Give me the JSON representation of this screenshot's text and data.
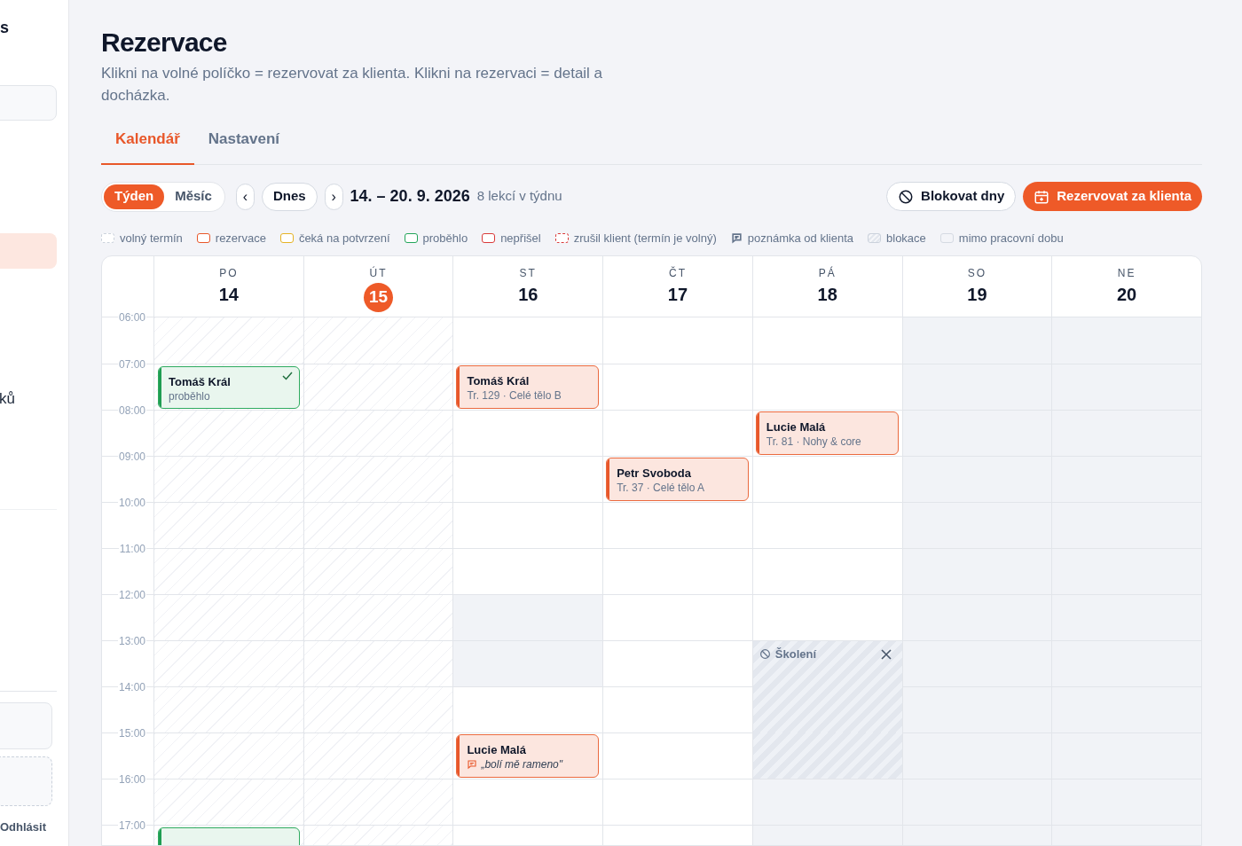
{
  "sidebar": {
    "heading_fragment": "s",
    "items": [
      {
        "selected": true
      },
      {
        "label": "ků",
        "selected": false
      }
    ],
    "logout": "Odhlásit"
  },
  "page": {
    "title": "Rezervace",
    "subtitle": "Klikni na volné políčko = rezervovat za klienta. Klikni na rezervaci = detail a docházka."
  },
  "tabs": [
    {
      "label": "Kalendář",
      "selected": true
    },
    {
      "label": "Nastavení",
      "selected": false
    }
  ],
  "toolbar": {
    "views": [
      {
        "label": "Týden",
        "selected": true
      },
      {
        "label": "Měsíc",
        "selected": false
      }
    ],
    "prev": "‹",
    "today": "Dnes",
    "next": "›",
    "range": "14. – 20. 9. 2026",
    "count": "8 lekcí v týdnu",
    "block_button": "Blokovat dny",
    "book_button": "Rezervovat za klienta"
  },
  "legend": [
    {
      "label": "volný termín",
      "kind": "dashed",
      "color": "#cbd2dc"
    },
    {
      "label": "rezervace",
      "kind": "solid",
      "color": "#e8572a"
    },
    {
      "label": "čeká na potvrzení",
      "kind": "solid",
      "color": "#e6b325"
    },
    {
      "label": "proběhlo",
      "kind": "solid",
      "color": "#22a55a"
    },
    {
      "label": "nepřišel",
      "kind": "solid",
      "color": "#d93a3a"
    },
    {
      "label": "zrušil klient (termín je volný)",
      "kind": "dashed",
      "color": "#d93a3a"
    },
    {
      "label": "poznámka od klienta",
      "kind": "icon",
      "color": "#64748b"
    },
    {
      "label": "blokace",
      "kind": "hatched",
      "color": "#cbd2dc"
    },
    {
      "label": "mimo pracovní dobu",
      "kind": "muted",
      "color": "#d5dae2"
    }
  ],
  "calendar": {
    "days": [
      {
        "weekday": "PO",
        "date": "14",
        "today": false
      },
      {
        "weekday": "ÚT",
        "date": "15",
        "today": true
      },
      {
        "weekday": "ST",
        "date": "16",
        "today": false
      },
      {
        "weekday": "ČT",
        "date": "17",
        "today": false
      },
      {
        "weekday": "PÁ",
        "date": "18",
        "today": false
      },
      {
        "weekday": "SO",
        "date": "19",
        "today": false
      },
      {
        "weekday": "NE",
        "date": "20",
        "today": false
      }
    ],
    "rows": [
      {
        "hour": "06:00",
        "cells": [
          {
            "kind": "past"
          },
          {
            "kind": "past"
          },
          {
            "kind": "free"
          },
          {
            "kind": "free"
          },
          {
            "kind": "free"
          },
          {
            "kind": "off"
          },
          {
            "kind": "off"
          }
        ]
      },
      {
        "hour": "07:00",
        "cells": [
          {
            "kind": "past",
            "event": {
              "kind": "done",
              "name": "Tomáš Král",
              "detail": "proběhlo"
            }
          },
          {
            "kind": "past"
          },
          {
            "kind": "free",
            "event": {
              "kind": "booked",
              "name": "Tomáš Král",
              "detail": "Tr. 129 · Celé tělo B"
            }
          },
          {
            "kind": "free"
          },
          {
            "kind": "free"
          },
          {
            "kind": "off"
          },
          {
            "kind": "off"
          }
        ]
      },
      {
        "hour": "08:00",
        "cells": [
          {
            "kind": "past"
          },
          {
            "kind": "past"
          },
          {
            "kind": "free"
          },
          {
            "kind": "free"
          },
          {
            "kind": "free",
            "event": {
              "kind": "booked",
              "name": "Lucie Malá",
              "detail": "Tr. 81 · Nohy & core"
            }
          },
          {
            "kind": "off"
          },
          {
            "kind": "off"
          }
        ]
      },
      {
        "hour": "09:00",
        "cells": [
          {
            "kind": "past"
          },
          {
            "kind": "past"
          },
          {
            "kind": "free"
          },
          {
            "kind": "free",
            "event": {
              "kind": "booked",
              "name": "Petr Svoboda",
              "detail": "Tr. 37 · Celé tělo A"
            }
          },
          {
            "kind": "free"
          },
          {
            "kind": "off"
          },
          {
            "kind": "off"
          }
        ]
      },
      {
        "hour": "10:00",
        "cells": [
          {
            "kind": "past"
          },
          {
            "kind": "past"
          },
          {
            "kind": "free"
          },
          {
            "kind": "free"
          },
          {
            "kind": "free"
          },
          {
            "kind": "off"
          },
          {
            "kind": "off"
          }
        ]
      },
      {
        "hour": "11:00",
        "cells": [
          {
            "kind": "past"
          },
          {
            "kind": "past"
          },
          {
            "kind": "free"
          },
          {
            "kind": "free"
          },
          {
            "kind": "free"
          },
          {
            "kind": "off"
          },
          {
            "kind": "off"
          }
        ]
      },
      {
        "hour": "12:00",
        "cells": [
          {
            "kind": "past"
          },
          {
            "kind": "past"
          },
          {
            "kind": "off"
          },
          {
            "kind": "free"
          },
          {
            "kind": "free"
          },
          {
            "kind": "off"
          },
          {
            "kind": "off"
          }
        ]
      },
      {
        "hour": "13:00",
        "cells": [
          {
            "kind": "past"
          },
          {
            "kind": "past"
          },
          {
            "kind": "off"
          },
          {
            "kind": "free"
          },
          {
            "kind": "blocked",
            "label": "Školení"
          },
          {
            "kind": "off"
          },
          {
            "kind": "off"
          }
        ]
      },
      {
        "hour": "14:00",
        "cells": [
          {
            "kind": "past"
          },
          {
            "kind": "past"
          },
          {
            "kind": "free"
          },
          {
            "kind": "free"
          },
          {
            "kind": "blocked"
          },
          {
            "kind": "off"
          },
          {
            "kind": "off"
          }
        ]
      },
      {
        "hour": "15:00",
        "cells": [
          {
            "kind": "past"
          },
          {
            "kind": "past"
          },
          {
            "kind": "free",
            "event": {
              "kind": "booked",
              "name": "Lucie Malá",
              "note": "„bolí mě rameno\""
            }
          },
          {
            "kind": "free"
          },
          {
            "kind": "blocked"
          },
          {
            "kind": "off"
          },
          {
            "kind": "off"
          }
        ]
      },
      {
        "hour": "16:00",
        "cells": [
          {
            "kind": "past"
          },
          {
            "kind": "past"
          },
          {
            "kind": "free"
          },
          {
            "kind": "free"
          },
          {
            "kind": "off"
          },
          {
            "kind": "off"
          },
          {
            "kind": "off"
          }
        ]
      },
      {
        "hour": "17:00",
        "cells": [
          {
            "kind": "past",
            "event": {
              "kind": "done"
            }
          },
          {
            "kind": "past"
          },
          {
            "kind": "free"
          },
          {
            "kind": "free"
          },
          {
            "kind": "off"
          },
          {
            "kind": "off"
          },
          {
            "kind": "off"
          }
        ]
      }
    ]
  }
}
